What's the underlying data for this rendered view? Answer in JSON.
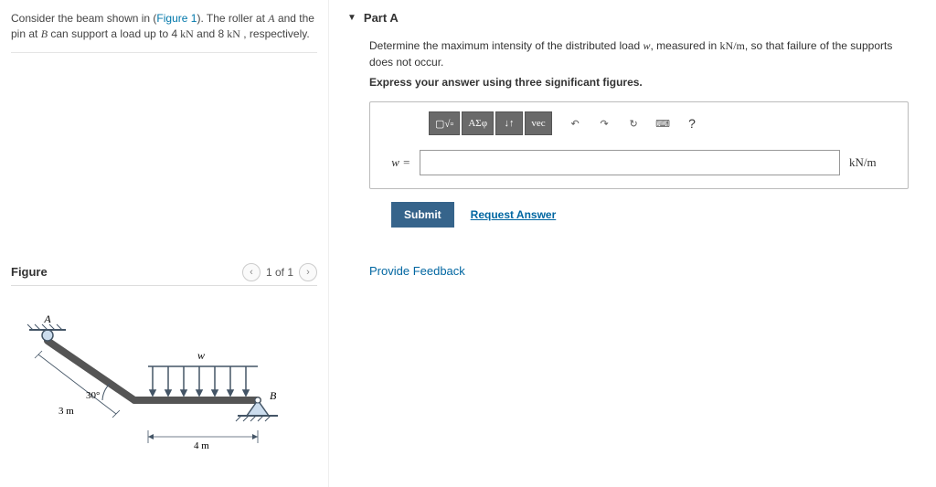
{
  "problem": {
    "prefix": "Consider the beam shown in (",
    "figref": "Figure 1",
    "mid": "). The roller at ",
    "varA": "A",
    "mid2": " and the pin at ",
    "varB": "B",
    "mid3": " can support a load up to ",
    "loadA_val": "4",
    "loadA_unit": " kN",
    "and": " and ",
    "loadB_val": "8",
    "loadB_unit": " kN",
    "suffix": " , respectively."
  },
  "figure": {
    "title": "Figure",
    "page": "1 of 1",
    "labels": {
      "A": "A",
      "B": "B",
      "w": "w",
      "angle": "30°",
      "dim1": "3 m",
      "dim2": "4 m"
    }
  },
  "partA": {
    "header": "Part A",
    "q_prefix": "Determine the maximum intensity of the distributed load ",
    "q_var": "w",
    "q_mid": ", measured in ",
    "q_unit": "kN/m",
    "q_suffix": ", so that failure of the supports does not occur.",
    "instruct": "Express your answer using three significant figures.",
    "var_label": "w =",
    "unit_label": "kN/m",
    "toolbar": {
      "templates": "▢√▫",
      "greek": "ΑΣφ",
      "subsup": "↓↑",
      "vec": "vec",
      "undo": "↶",
      "redo": "↷",
      "reset": "↻",
      "keyboard": "⌨",
      "help": "?"
    },
    "submit": "Submit",
    "request": "Request Answer"
  },
  "feedback": "Provide Feedback"
}
